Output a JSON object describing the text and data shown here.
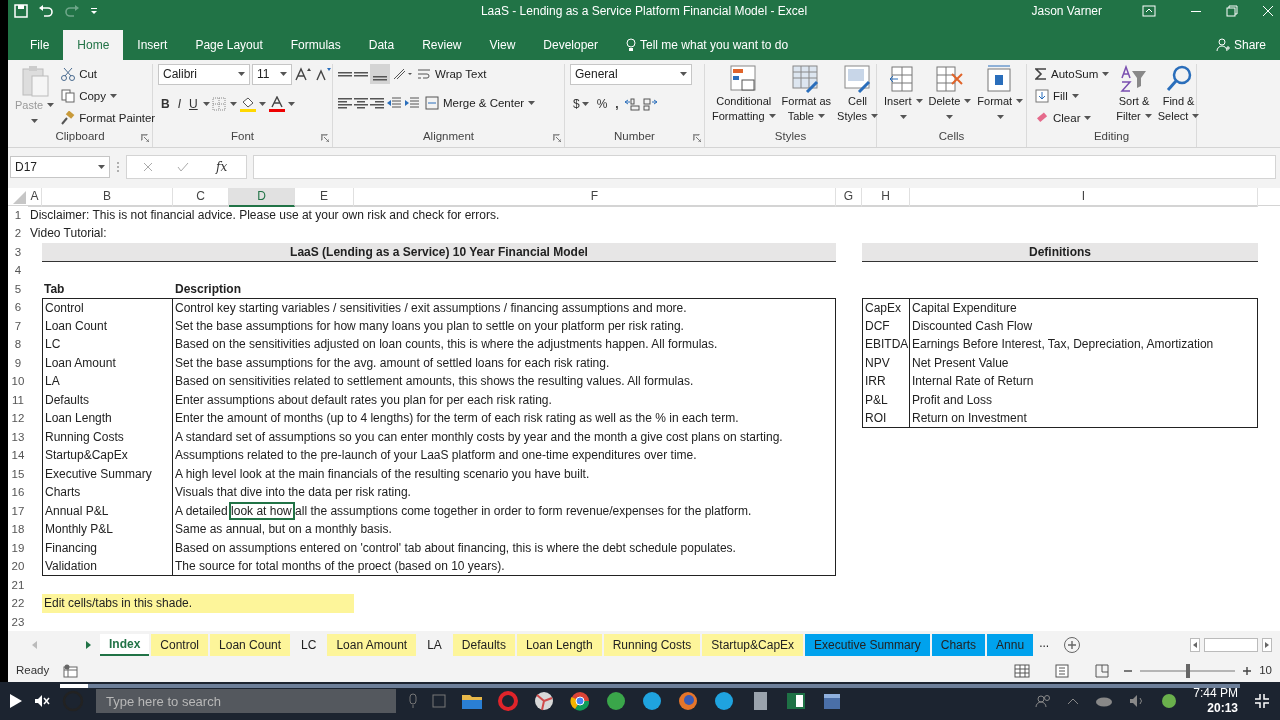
{
  "window": {
    "title": "LaaS - Lending as a Service Platform Financial Model  -  Excel",
    "user": "Jason Varner"
  },
  "ribbon_tabs": [
    {
      "label": "File",
      "selected": false
    },
    {
      "label": "Home",
      "selected": true
    },
    {
      "label": "Insert",
      "selected": false
    },
    {
      "label": "Page Layout",
      "selected": false
    },
    {
      "label": "Formulas",
      "selected": false
    },
    {
      "label": "Data",
      "selected": false
    },
    {
      "label": "Review",
      "selected": false
    },
    {
      "label": "View",
      "selected": false
    },
    {
      "label": "Developer",
      "selected": false
    }
  ],
  "tell_me": "Tell me what you want to do",
  "share": "Share",
  "clipboard": {
    "label": "Clipboard",
    "paste": "Paste",
    "paste_disabled": true,
    "cut": "Cut",
    "copy": "Copy",
    "format_painter": "Format Painter"
  },
  "font": {
    "label": "Font",
    "name": "Calibri",
    "size": "11",
    "bold": "B",
    "italic": "I",
    "underline": "U"
  },
  "alignment": {
    "label": "Alignment",
    "wrap": "Wrap Text",
    "merge": "Merge & Center"
  },
  "number": {
    "label": "Number",
    "format": "General",
    "currency": "$",
    "percent": "%",
    "comma": ","
  },
  "styles": {
    "label": "Styles",
    "buttons": [
      {
        "lines": [
          "Conditional",
          "Formatting"
        ]
      },
      {
        "lines": [
          "Format as",
          "Table"
        ]
      },
      {
        "lines": [
          "Cell",
          "Styles"
        ]
      }
    ]
  },
  "cells": {
    "label": "Cells",
    "buttons": [
      {
        "lines": [
          "Insert"
        ]
      },
      {
        "lines": [
          "Delete"
        ]
      },
      {
        "lines": [
          "Format"
        ]
      }
    ]
  },
  "editing": {
    "label": "Editing",
    "autosum": "AutoSum",
    "fill": "Fill",
    "clear": "Clear",
    "sort": [
      "Sort &",
      "Filter"
    ],
    "find": [
      "Find &",
      "Select"
    ]
  },
  "formula_bar": {
    "name_box": "D17",
    "fx": "fx"
  },
  "columns": [
    {
      "label": "A",
      "selected": false
    },
    {
      "label": "B",
      "selected": false
    },
    {
      "label": "C",
      "selected": false
    },
    {
      "label": "D",
      "selected": true
    },
    {
      "label": "E",
      "selected": false
    },
    {
      "label": "F",
      "selected": false
    },
    {
      "label": "G",
      "selected": false
    },
    {
      "label": "H",
      "selected": false
    },
    {
      "label": "I",
      "selected": false
    }
  ],
  "row_numbers": [
    "1",
    "2",
    "3",
    "4",
    "5",
    "6",
    "7",
    "8",
    "9",
    "10",
    "11",
    "12",
    "13",
    "14",
    "15",
    "16",
    "17",
    "18",
    "19",
    "20",
    "21",
    "22",
    "23"
  ],
  "sheet": {
    "disclaimer": "Disclaimer: This is not financial advice. Please use at your own risk and check for errors.",
    "video_tutorial": "Video Tutorial:",
    "model_title": "LaaS (Lending as a Service) 10 Year Financial Model",
    "definitions_title": "Definitions",
    "tab_header": "Tab",
    "description_header": "Description",
    "tabs": [
      {
        "tab": "Control",
        "description": "Control key starting variables / sensitivities / exit assumptions / financing assumptions and more.",
        "selected": false
      },
      {
        "tab": "Loan Count",
        "description": "Set the base assumptions for how many loans you plan to settle on your platform per risk rating.",
        "selected": false
      },
      {
        "tab": "LC",
        "description": "Based on the sensitivities adjusted on loan counts, this is where the adjustments happen. All formulas.",
        "selected": false
      },
      {
        "tab": "Loan Amount",
        "description": "Set the base assumptions for the avg. amount of settled loans for each risk rating.",
        "selected": false
      },
      {
        "tab": "LA",
        "description": "Based on sensitivities related to settlement amounts, this shows the resulting values. All formulas.",
        "selected": false
      },
      {
        "tab": "Defaults",
        "description": "Enter assumptions about default rates you plan for per each risk rating.",
        "selected": false
      },
      {
        "tab": "Loan Length",
        "description": "Enter the amount of months (up to 4 lengths) for the term of each risk rating as well as the % in each term.",
        "selected": false
      },
      {
        "tab": "Running Costs",
        "description": "A standard set of assumptions so you can enter monthly costs by year and the month a give cost plans on starting.",
        "selected": false
      },
      {
        "tab": "Startup&CapEx",
        "description": "Assumptions related to the pre-launch of your LaaS platform and one-time expenditures over time.",
        "selected": false
      },
      {
        "tab": "Executive Summary",
        "description": "A high level look at the main financials of the resulting scenario you have built.",
        "selected": false
      },
      {
        "tab": "Charts",
        "description": "Visuals that dive into the data per risk rating.",
        "selected": false
      },
      {
        "tab": "Annual P&L",
        "description": "A detailed look at how all the assumptions come together in order to form revenue/expenses for the platform.",
        "selected": true
      },
      {
        "tab": "Monthly P&L",
        "description": "Same as annual, but on a monthly basis.",
        "selected": false
      },
      {
        "tab": "Financing",
        "description": "Based on assumptions entered on 'control' tab about financing, this is where the debt schedule populates.",
        "selected": false
      },
      {
        "tab": "Validation",
        "description": "The source for total months of the proect (based on 10 years).",
        "selected": false
      }
    ],
    "definitions": [
      {
        "term": "CapEx",
        "meaning": "Capital Expenditure"
      },
      {
        "term": "DCF",
        "meaning": "Discounted Cash Flow"
      },
      {
        "term": "EBITDA",
        "meaning": "Earnings Before Interest, Tax, Depreciation, Amortization"
      },
      {
        "term": "NPV",
        "meaning": "Net Present Value"
      },
      {
        "term": "IRR",
        "meaning": "Internal Rate of Return"
      },
      {
        "term": "P&L",
        "meaning": "Profit and Loss"
      },
      {
        "term": "ROI",
        "meaning": "Return on Investment"
      }
    ],
    "note": "Edit cells/tabs in this shade."
  },
  "sheet_tabs": [
    {
      "label": "Index",
      "selected": true
    },
    {
      "label": "Control",
      "selected": false,
      "color": "#fdf59a"
    },
    {
      "label": "Loan Count",
      "selected": false,
      "color": "#fdf59a"
    },
    {
      "label": "LC",
      "selected": false
    },
    {
      "label": "Loan Amount",
      "selected": false,
      "color": "#fdf59a"
    },
    {
      "label": "LA",
      "selected": false
    },
    {
      "label": "Defaults",
      "selected": false,
      "color": "#fdf59a"
    },
    {
      "label": "Loan Length",
      "selected": false,
      "color": "#fdf59a"
    },
    {
      "label": "Running Costs",
      "selected": false,
      "color": "#fdf59a"
    },
    {
      "label": "Startup&CapEx",
      "selected": false,
      "color": "#fdf59a"
    },
    {
      "label": "Executive Summary",
      "selected": false,
      "color": "#00a2ed"
    },
    {
      "label": "Charts",
      "selected": false,
      "color": "#00a2ed"
    },
    {
      "label": "Annu",
      "selected": false,
      "color": "#00a2ed"
    }
  ],
  "more_tabs": "...",
  "status_bar": {
    "text": "Ready",
    "zoom": "10",
    "zoom_slider": {
      "level": 0.5
    }
  },
  "taskbar": {
    "search_placeholder": "Type here to search",
    "time": "7:44 PM"
  },
  "video": {
    "elapsed": "20:13",
    "level": 0.024
  }
}
